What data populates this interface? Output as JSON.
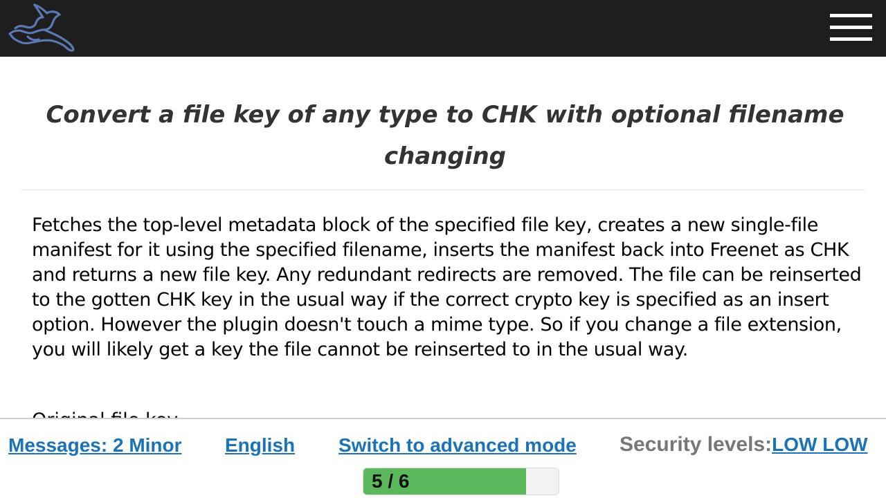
{
  "header": {
    "logo_icon": "freenet-rabbit-logo-icon",
    "menu_icon": "hamburger-menu-icon",
    "background": "#1e1e1e"
  },
  "main": {
    "title": "Convert a file key of any type to CHK with optional filename changing",
    "description": "Fetches the top-level metadata block of the specified file key, creates a new single-file manifest for it using the specified filename, inserts the manifest back into Freenet as CHK and returns a new file key. Any redundant redirects are removed. The file can be reinserted to the gotten CHK key in the usual way if the correct crypto key is specified as an insert option. However the plugin doesn't touch a mime type. So if you change a file extension, you will likely get a key the file cannot be reinserted to in the usual way.",
    "next_label_partial": "Original file key"
  },
  "footer": {
    "messages_link": "Messages: 2 Minor",
    "language_link": "English",
    "mode_link": "Switch to advanced mode",
    "security_label": "Security levels:",
    "security_value": "LOW LOW",
    "progress": {
      "text": "5 / 6",
      "done": 5,
      "total": 6,
      "color": "#5cb85c"
    }
  },
  "colors": {
    "link": "#1a73b8",
    "security_label": "#777777",
    "title": "#333333"
  }
}
